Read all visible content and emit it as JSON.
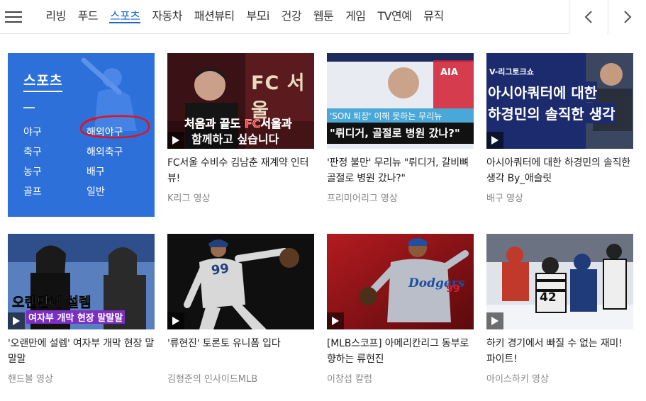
{
  "nav": {
    "tabs": [
      "리빙",
      "푸드",
      "스포츠",
      "자동차",
      "패션뷰티",
      "부모i",
      "건강",
      "웹툰",
      "게임",
      "TV연예",
      "뮤직"
    ],
    "active_tab": "스포츠",
    "menu_icon": "hamburger-menu-icon",
    "prev_icon": "chevron-left-icon",
    "next_icon": "chevron-right-icon"
  },
  "sports_box": {
    "title": "스포츠",
    "links": [
      "야구",
      "해외야구",
      "축구",
      "해외축구",
      "농구",
      "배구",
      "골프",
      "일반"
    ],
    "accent_color": "#2d70da"
  },
  "cards": [
    {
      "thumb_caption_line1": "처음과 끝도 FC서울과",
      "thumb_caption_line2": "함께하고 싶습니다",
      "thumb_badge": "FC 서울",
      "title": "FC서울 수비수 김남춘 재계약 인터뷰!",
      "source": "K리그 영상"
    },
    {
      "thumb_caption_line1": "'SON 퇴장' 이해 못하는 무리뉴",
      "thumb_caption_line2": "\"뤼디거, 골절로 병원 갔나?\"",
      "thumb_badge": "AIA",
      "title": "'판정 불만' 무리뉴 \"뤼디거, 갈비뼈 골절로 병원 갔나?\"",
      "source": "프리미어리그 영상"
    },
    {
      "thumb_caption_line1": "V-리그토크쇼",
      "thumb_caption_line2": "아시아쿼터에 대한",
      "thumb_caption_line3": "하경민의 솔직한 생각",
      "title": "아시아쿼터에 대한 하경민의 솔직한 생각 By_애슬릿",
      "source": "배구 영상"
    },
    {
      "thumb_caption_line1": "오랜만에 설렘",
      "thumb_caption_line2": "여자부 개막 현장 말말말",
      "title": "'오랜만에 설렘' 여자부 개막 현장 말말말",
      "source": "핸드볼 영상"
    },
    {
      "thumb_jersey": "99",
      "title": "'류현진' 토론토 유니폼 입다",
      "source": "김형준의 인사이드MLB"
    },
    {
      "thumb_jersey": "99",
      "thumb_badge": "Dodgers",
      "title": "[MLB스코프] 아메리칸리그 동부로 향하는 류현진",
      "source": "이창섭 칼럼"
    },
    {
      "thumb_jersey": "42",
      "title": "하키 경기에서 빠질 수 없는 재미! 파이트!",
      "source": "아이스하키 영상"
    }
  ]
}
